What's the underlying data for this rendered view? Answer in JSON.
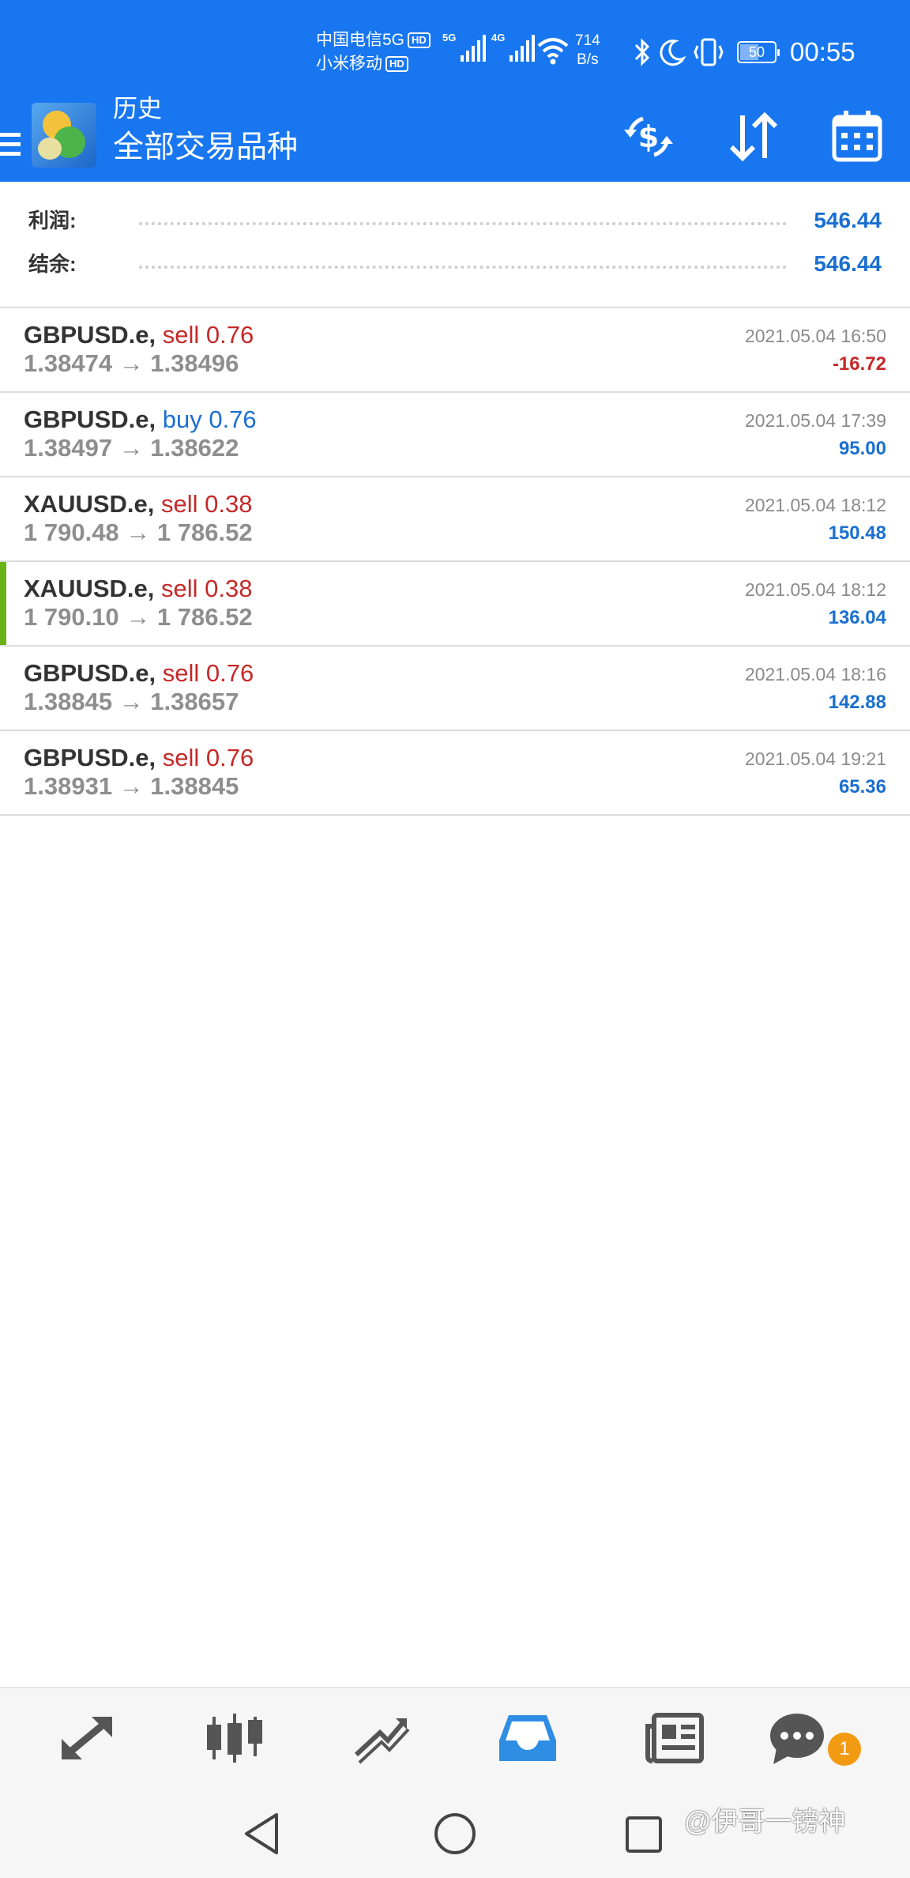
{
  "status_bar": {
    "carrier1": "中国电信5G",
    "carrier2": "小米移动",
    "hd_label": "HD",
    "sig1_label": "5G",
    "sig2_label": "4G",
    "speed_value": "714",
    "speed_unit": "B/s",
    "battery": "50",
    "time": "00:55"
  },
  "app_bar": {
    "title_small": "历史",
    "title_big": "全部交易品种",
    "icons": [
      "menu-icon",
      "currency-exchange-icon",
      "sort-icon",
      "calendar-icon"
    ]
  },
  "summary": {
    "profit_label": "利润:",
    "profit_value": "546.44",
    "balance_label": "结余:",
    "balance_value": "546.44"
  },
  "trades": [
    {
      "symbol": "GBPUSD.e,",
      "side": "sell 0.76",
      "prices": "1.38474 → 1.38496",
      "time": "2021.05.04 16:50",
      "profit": "-16.72"
    },
    {
      "symbol": "GBPUSD.e,",
      "side": "buy 0.76",
      "prices": "1.38497 → 1.38622",
      "time": "2021.05.04 17:39",
      "profit": "95.00"
    },
    {
      "symbol": "XAUUSD.e,",
      "side": "sell 0.38",
      "prices": "1 790.48 → 1 786.52",
      "time": "2021.05.04 18:12",
      "profit": "150.48"
    },
    {
      "symbol": "XAUUSD.e,",
      "side": "sell 0.38",
      "prices": "1 790.10 → 1 786.52",
      "time": "2021.05.04 18:12",
      "profit": "136.04"
    },
    {
      "symbol": "GBPUSD.e,",
      "side": "sell 0.76",
      "prices": "1.38845 → 1.38657",
      "time": "2021.05.04 18:16",
      "profit": "142.88"
    },
    {
      "symbol": "GBPUSD.e,",
      "side": "sell 0.76",
      "prices": "1.38931 → 1.38845",
      "time": "2021.05.04 19:21",
      "profit": "65.36"
    }
  ],
  "bottom_nav": {
    "items": [
      "quotes-icon",
      "chart-icon",
      "trade-icon",
      "history-icon",
      "news-icon",
      "chat-icon"
    ],
    "active": "history-icon",
    "chat_badge": "1"
  },
  "watermark": "@伊哥一镑神",
  "colors": {
    "primary": "#1877F0",
    "sell": "#c62828",
    "buy": "#1a6fd0",
    "accent": "#6ab314",
    "badge": "#f29b12"
  }
}
